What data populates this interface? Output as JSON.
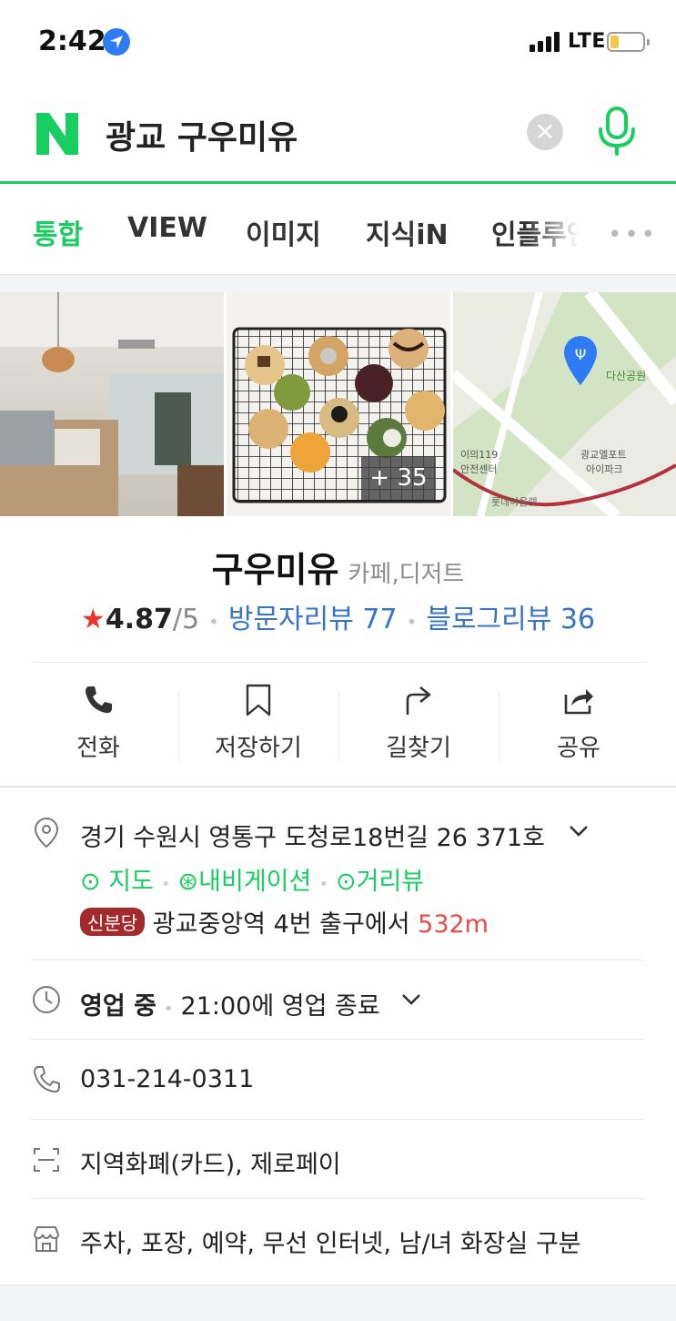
{
  "status": {
    "time": "2:42",
    "network": "LTE"
  },
  "search": {
    "query": "광교 구우미유",
    "clear": "×"
  },
  "tabs": [
    "통합",
    "VIEW",
    "이미지",
    "지식iN",
    "인플루언"
  ],
  "tabs_more": "•••",
  "photos": {
    "more_count": "+ 35"
  },
  "map_labels": {
    "park": "다산공원",
    "safety": "이의119",
    "safety2": "안전센터",
    "building": "광교엘포트",
    "building2": "아이파크",
    "outlet": "롯데아울렛"
  },
  "place": {
    "name": "구우미유",
    "category": "카페,디저트",
    "rating": "4.87",
    "rating_max": "/5",
    "visitor_reviews": "방문자리뷰 77",
    "blog_reviews": "블로그리뷰 36"
  },
  "actions": [
    "전화",
    "저장하기",
    "길찾기",
    "공유"
  ],
  "info": {
    "address": "경기 수원시 영통구 도청로18번길 26 371호",
    "link_map": "지도",
    "link_navi": "내비게이션",
    "link_street": "거리뷰",
    "line_badge": "신분당",
    "transit": "광교중앙역 4번 출구에서",
    "distance": "532m",
    "open_status": "영업 중",
    "hours": "21:00에 영업 종료",
    "phone": "031-214-0311",
    "payment": "지역화폐(카드), 제로페이",
    "facilities": "주차, 포장, 예약, 무선 인터넷, 남/녀 화장실 구분"
  },
  "colors": {
    "accent": "#19ce60",
    "link": "#3774c5",
    "star": "#e9362a",
    "distance": "#e94b4b",
    "badge": "#a32a2a"
  }
}
